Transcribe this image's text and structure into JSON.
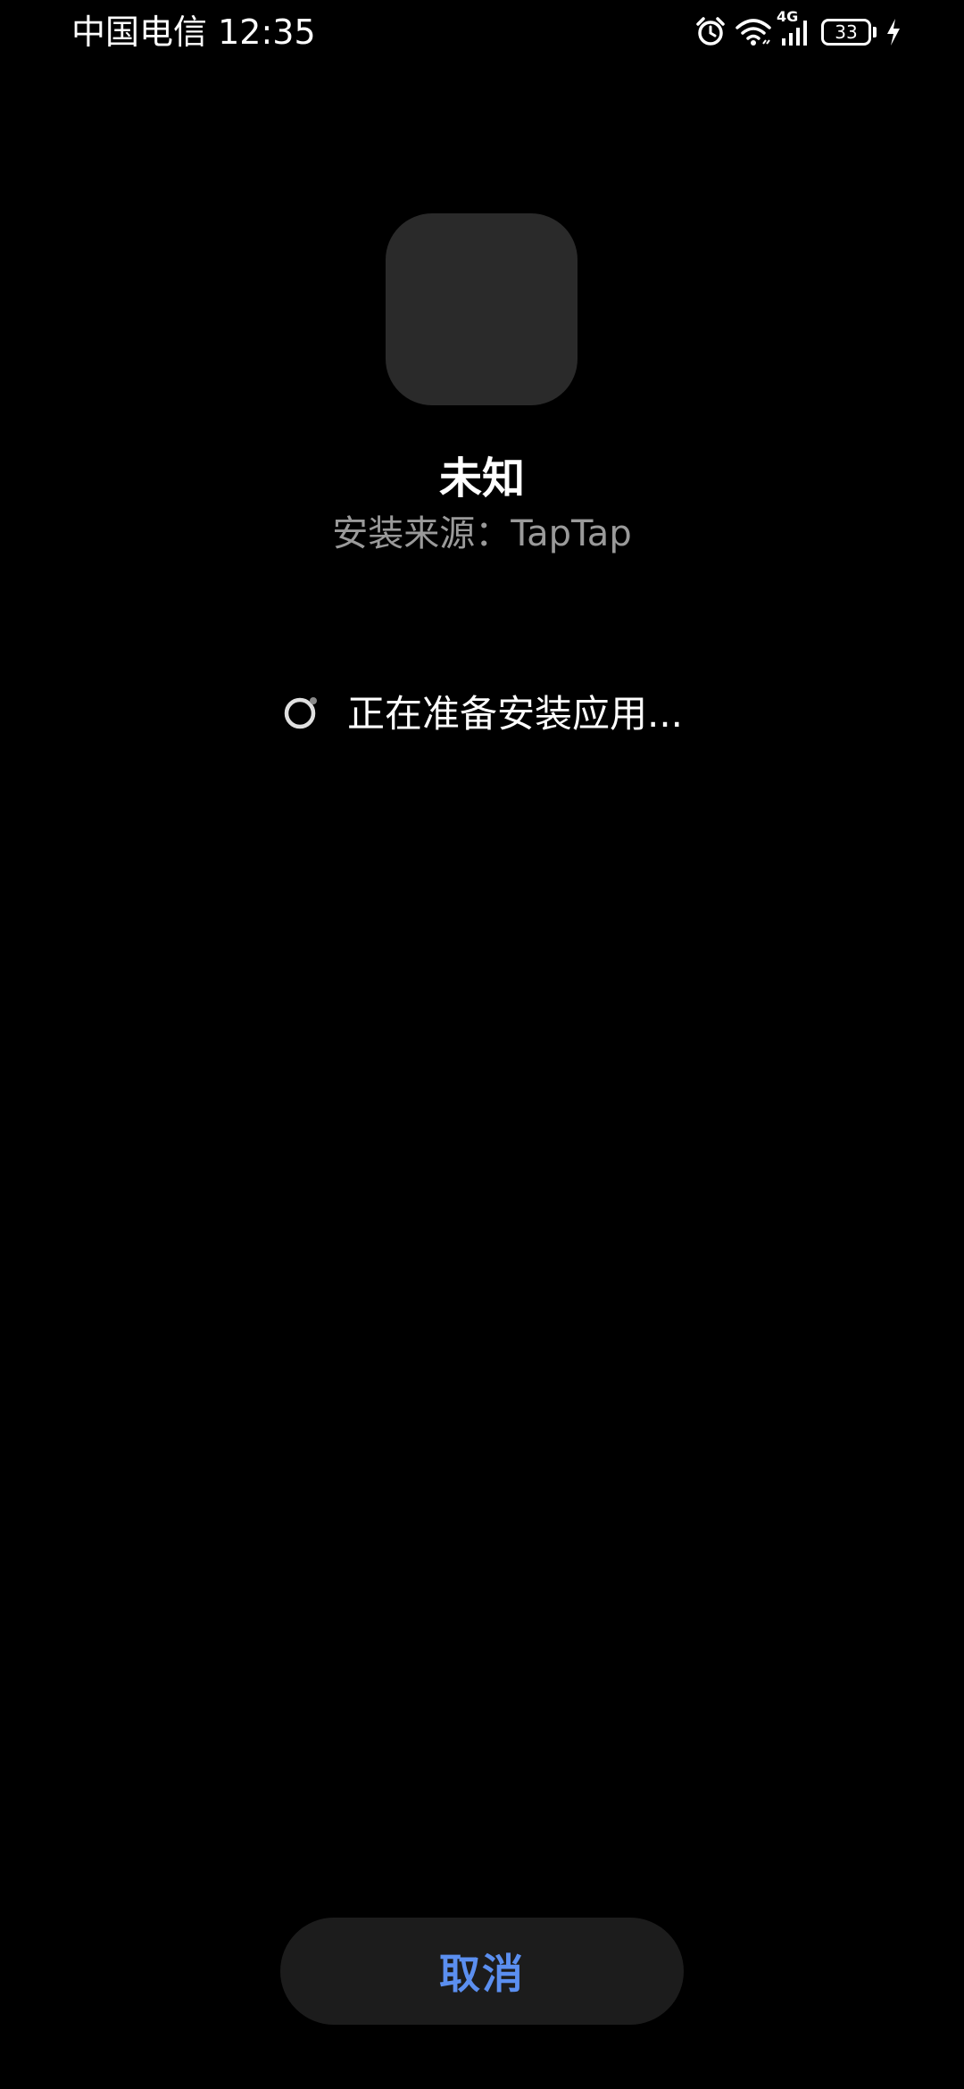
{
  "status_bar": {
    "carrier": "中国电信",
    "time": "12:35",
    "network_type": "4G",
    "battery_level": "33",
    "icons": [
      "alarm-icon",
      "wifi-icon",
      "cellular-signal-icon",
      "battery-icon",
      "charging-icon"
    ]
  },
  "app": {
    "name": "未知",
    "install_source": "安装来源：TapTap"
  },
  "progress": {
    "text": "正在准备安装应用..."
  },
  "actions": {
    "cancel_label": "取消"
  },
  "colors": {
    "background": "#000000",
    "icon_placeholder": "#2a2a2a",
    "secondary_text": "#9a9a9a",
    "button_background": "#1c1c1c",
    "accent": "#5b8ff0"
  }
}
